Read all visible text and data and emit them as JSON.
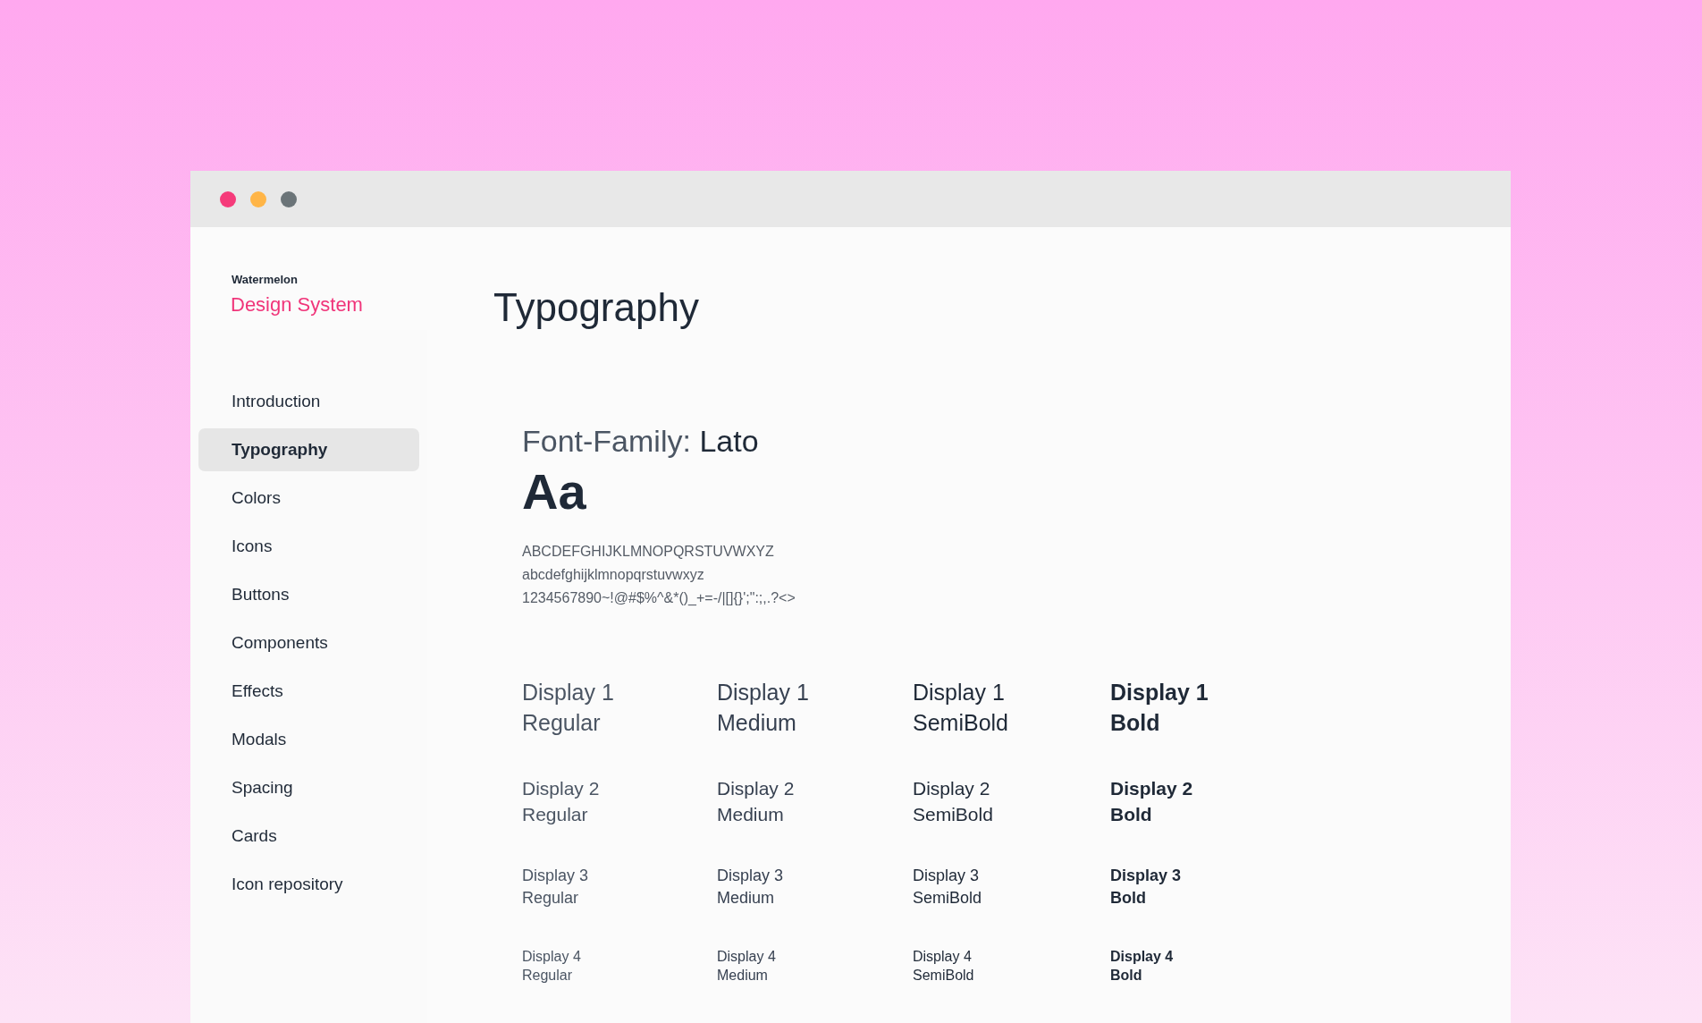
{
  "window": {
    "controls": [
      {
        "color": "#f53b7a"
      },
      {
        "color": "#ffb547"
      },
      {
        "color": "#6b7478"
      }
    ]
  },
  "sidebar": {
    "brand": "Watermelon",
    "product": "Design System",
    "items": [
      {
        "label": "Introduction",
        "selected": false
      },
      {
        "label": "Typography",
        "selected": true
      },
      {
        "label": "Colors",
        "selected": false
      },
      {
        "label": "Icons",
        "selected": false
      },
      {
        "label": "Buttons",
        "selected": false
      },
      {
        "label": "Components",
        "selected": false
      },
      {
        "label": "Effects",
        "selected": false
      },
      {
        "label": "Modals",
        "selected": false
      },
      {
        "label": "Spacing",
        "selected": false
      },
      {
        "label": "Cards",
        "selected": false
      },
      {
        "label": "Icon repository",
        "selected": false
      }
    ]
  },
  "page_title": "Typography",
  "font_family": {
    "label": "Font-Family:",
    "value": "Lato",
    "sample": "Aa",
    "glyph_lines": [
      "ABCDEFGHIJKLMNOPQRSTUVWXYZ",
      "abcdefghijklmnopqrstuvwxyz",
      "1234567890~!@#$%^&*()_+=-/|[]{}';\":;,.?<>"
    ]
  },
  "type_scale": [
    {
      "kind": "d1",
      "cells": [
        {
          "kind": "regular",
          "name": "Display 1",
          "weight": "Regular"
        },
        {
          "kind": "medium",
          "name": "Display 1",
          "weight": "Medium"
        },
        {
          "kind": "semibold",
          "name": "Display 1",
          "weight": "SemiBold"
        },
        {
          "kind": "bold",
          "name": "Display 1",
          "weight": "Bold"
        }
      ]
    },
    {
      "kind": "d2",
      "cells": [
        {
          "kind": "regular",
          "name": "Display 2",
          "weight": "Regular"
        },
        {
          "kind": "medium",
          "name": "Display 2",
          "weight": "Medium"
        },
        {
          "kind": "semibold",
          "name": "Display 2",
          "weight": "SemiBold"
        },
        {
          "kind": "bold",
          "name": "Display 2",
          "weight": "Bold"
        }
      ]
    },
    {
      "kind": "d3",
      "cells": [
        {
          "kind": "regular",
          "name": "Display 3",
          "weight": "Regular"
        },
        {
          "kind": "medium",
          "name": "Display 3",
          "weight": "Medium"
        },
        {
          "kind": "semibold",
          "name": "Display 3",
          "weight": "SemiBold"
        },
        {
          "kind": "bold",
          "name": "Display 3",
          "weight": "Bold"
        }
      ]
    },
    {
      "kind": "d4",
      "cells": [
        {
          "kind": "regular",
          "name": "Display 4",
          "weight": "Regular"
        },
        {
          "kind": "medium",
          "name": "Display 4",
          "weight": "Medium"
        },
        {
          "kind": "semibold",
          "name": "Display 4",
          "weight": "SemiBold"
        },
        {
          "kind": "bold",
          "name": "Display 4",
          "weight": "Bold"
        }
      ]
    }
  ]
}
